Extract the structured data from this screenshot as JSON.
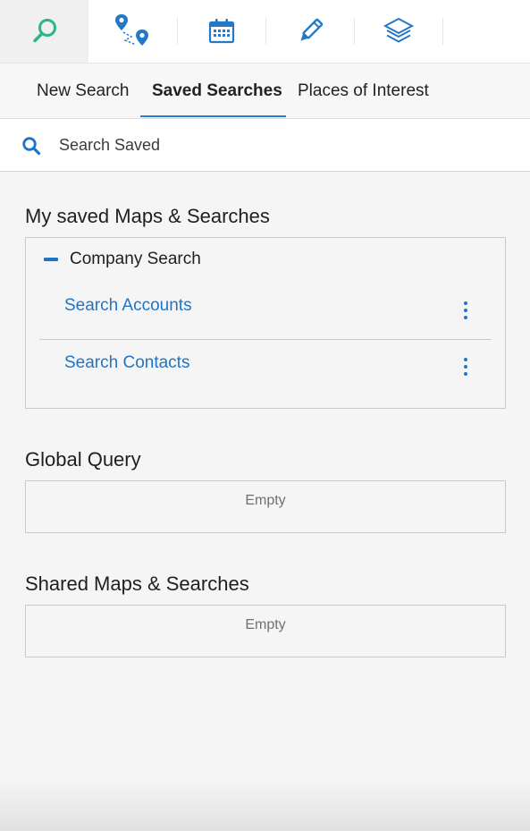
{
  "toolbar": {
    "tools": [
      {
        "icon": "search-icon",
        "active": true
      },
      {
        "icon": "route-icon",
        "active": false
      },
      {
        "icon": "calendar-icon",
        "active": false
      },
      {
        "icon": "pencil-icon",
        "active": false
      },
      {
        "icon": "layers-icon",
        "active": false
      }
    ],
    "colors": {
      "active_icon": "#2fb38a",
      "icon": "#2478c8"
    }
  },
  "tabs": [
    {
      "label": "New Search",
      "active": false
    },
    {
      "label": "Saved Searches",
      "active": true
    },
    {
      "label": "Places of Interest",
      "active": false
    }
  ],
  "search": {
    "placeholder": "Search Saved",
    "value": ""
  },
  "sections": {
    "my_saved": {
      "title": "My saved Maps & Searches",
      "group": {
        "label": "Company Search",
        "items": [
          {
            "label": "Search Accounts"
          },
          {
            "label": "Search Contacts"
          }
        ]
      }
    },
    "global_query": {
      "title": "Global Query",
      "empty_text": "Empty"
    },
    "shared": {
      "title": "Shared Maps & Searches",
      "empty_text": "Empty"
    }
  },
  "theme": {
    "accent": "#1f74c7",
    "tab_underline": "#2b7fd0",
    "background": "#f5f5f5"
  }
}
